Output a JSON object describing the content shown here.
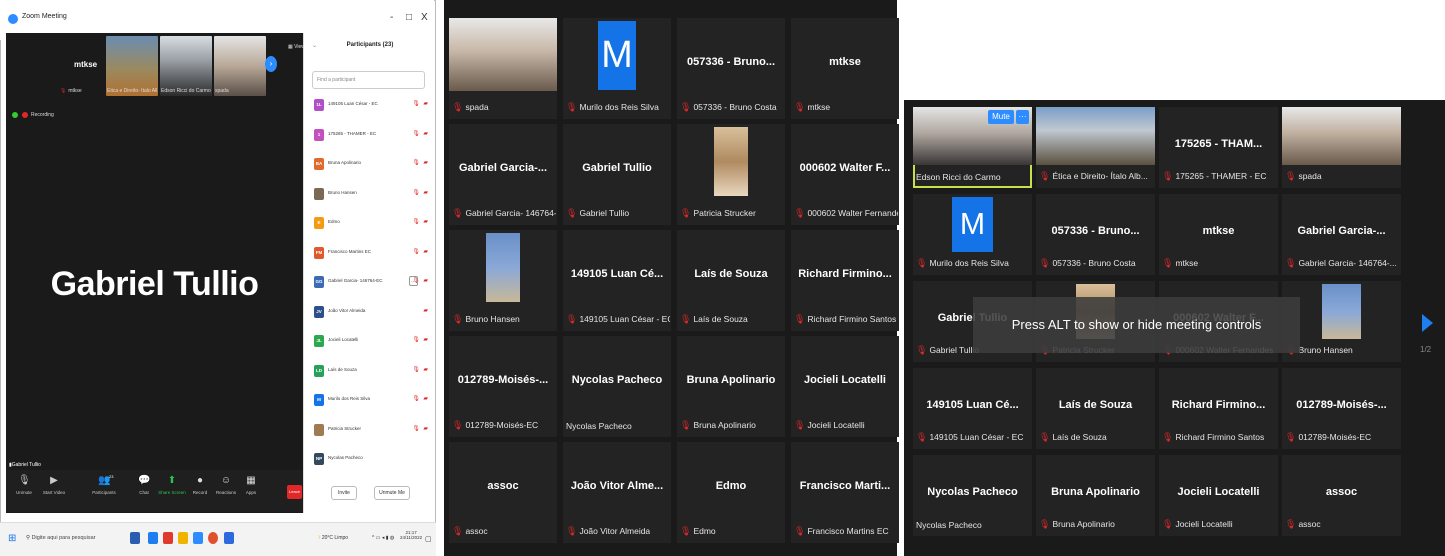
{
  "p1": {
    "title": "Zoom Meeting",
    "minimize_glyph": "-",
    "maximize_glyph": "□",
    "close_glyph": "X",
    "view_label": "View",
    "active_speaker": "Gabriel Tullio",
    "active_speaker_label": "Gabriel Tullio",
    "recording_label": "Recording",
    "strip": [
      {
        "name": "mtkse",
        "label": "mtkse"
      },
      {
        "label": "Ética e Direito- Ítalo Alb..."
      },
      {
        "label": "Edson Ricci do Carmo"
      },
      {
        "label": "spada"
      }
    ],
    "participants_title": "Participants (23)",
    "find_placeholder": "Find a participant",
    "participants": [
      {
        "initials": "1L",
        "name": "149105 Luan César - EC",
        "color": "#b04fc8"
      },
      {
        "initials": "1",
        "name": "175265 - THAMER - EC",
        "color": "#c34fc0"
      },
      {
        "initials": "BA",
        "name": "Bruna Apolinario",
        "color": "#e06a2c"
      },
      {
        "initials": "",
        "name": "Bruno Hansen",
        "color": "#7a6a55"
      },
      {
        "initials": "E",
        "name": "Edmo",
        "color": "#f39c12"
      },
      {
        "initials": "FM",
        "name": "Francisco Martins EC",
        "color": "#e05a2c"
      },
      {
        "initials": "GG",
        "name": "Gabriel Garcia- 146764-EC",
        "color": "#3d6ab5"
      },
      {
        "initials": "JV",
        "name": "João Vitor Almeida",
        "color": "#2d4f8a"
      },
      {
        "initials": "JL",
        "name": "Jocieli Locatelli",
        "color": "#2ea84f"
      },
      {
        "initials": "LD",
        "name": "Laís de Souza",
        "color": "#27a05a"
      },
      {
        "initials": "M",
        "name": "Murilo dos Reis Silva",
        "color": "#1473e6"
      },
      {
        "initials": "",
        "name": "Patricia Strucker",
        "color": "#a07a50"
      },
      {
        "initials": "NP",
        "name": "Nycolas Pacheco",
        "color": "#34495e"
      }
    ],
    "invite_label": "Invite",
    "unmute_me_label": "Unmute Me",
    "toolbar": [
      {
        "label": "Unmute",
        "icon": "mic-muted-icon",
        "glyph": "🎙"
      },
      {
        "label": "Start Video",
        "icon": "video-off-icon",
        "glyph": "▶"
      },
      {
        "label": "Participants",
        "icon": "participants-icon",
        "glyph": "👥",
        "badge": "23"
      },
      {
        "label": "Chat",
        "icon": "chat-icon",
        "glyph": "💬"
      },
      {
        "label": "Share Screen",
        "icon": "share-screen-icon",
        "glyph": "⬆"
      },
      {
        "label": "Record",
        "icon": "record-icon",
        "glyph": "●"
      },
      {
        "label": "Reactions",
        "icon": "reactions-icon",
        "glyph": "☺"
      },
      {
        "label": "Apps",
        "icon": "apps-icon",
        "glyph": "▦"
      }
    ],
    "leave_label": "Leave",
    "taskbar": {
      "search_placeholder": "Digite aqui para pesquisar",
      "weather": "20°C Limpo",
      "time": "21:17",
      "date": "24/11/2022"
    }
  },
  "p2": {
    "tiles": [
      {
        "type": "video",
        "label": "spada"
      },
      {
        "type": "letter",
        "letter": "M",
        "label": "Murilo dos Reis Silva"
      },
      {
        "type": "name",
        "name": "057336 - Bruno...",
        "label": "057336 - Bruno Costa"
      },
      {
        "type": "name",
        "name": "mtkse",
        "label": "mtkse"
      },
      {
        "type": "name",
        "name": "Gabriel Garcia-...",
        "label": "Gabriel Garcia- 146764-..."
      },
      {
        "type": "name",
        "name": "Gabriel Tullio",
        "label": "Gabriel Tullio"
      },
      {
        "type": "photo",
        "label": "Patricia Strucker"
      },
      {
        "type": "name",
        "name": "000602 Walter F...",
        "label": "000602 Walter Fernandes"
      },
      {
        "type": "photo",
        "label": "Bruno Hansen"
      },
      {
        "type": "name",
        "name": "149105 Luan Cé...",
        "label": "149105 Luan César - EC"
      },
      {
        "type": "name",
        "name": "Laís de Souza",
        "label": "Laís de Souza"
      },
      {
        "type": "name",
        "name": "Richard Firmino...",
        "label": "Richard Firmino Santos"
      },
      {
        "type": "name",
        "name": "012789-Moisés-...",
        "label": "012789-Moisés-EC"
      },
      {
        "type": "name",
        "name": "Nycolas Pacheco",
        "label": "Nycolas Pacheco",
        "nomic": true
      },
      {
        "type": "name",
        "name": "Bruna Apolinario",
        "label": "Bruna Apolinario"
      },
      {
        "type": "name",
        "name": "Jocieli Locatelli",
        "label": "Jocieli Locatelli"
      },
      {
        "type": "name",
        "name": "assoc",
        "label": "assoc"
      },
      {
        "type": "name",
        "name": "João Vitor Alme...",
        "label": "João Vitor Almeida"
      },
      {
        "type": "name",
        "name": "Edmo",
        "label": "Edmo"
      },
      {
        "type": "name",
        "name": "Francisco Marti...",
        "label": "Francisco Martins EC"
      }
    ]
  },
  "p3": {
    "mute_label": "Mute",
    "more_glyph": "···",
    "overlay_text": "Press ALT to show or hide meeting controls",
    "page_indicator": "1/2",
    "tiles": [
      {
        "type": "video",
        "label": "Edson Ricci do Carmo",
        "active": true,
        "nomic": true
      },
      {
        "type": "video",
        "label": "Ética e Direito- Ítalo Alb..."
      },
      {
        "type": "name",
        "name": "175265 - THAM...",
        "label": "175265 - THAMER - EC"
      },
      {
        "type": "video",
        "label": "spada"
      },
      {
        "type": "letter",
        "letter": "M",
        "label": "Murilo dos Reis Silva"
      },
      {
        "type": "name",
        "name": "057336 - Bruno...",
        "label": "057336 - Bruno Costa"
      },
      {
        "type": "name",
        "name": "mtkse",
        "label": "mtkse"
      },
      {
        "type": "name",
        "name": "Gabriel Garcia-...",
        "label": "Gabriel Garcia- 146764-..."
      },
      {
        "type": "name",
        "name": "Gabriel Tullio",
        "label": "Gabriel Tullio"
      },
      {
        "type": "photo",
        "label": "Patricia Strucker"
      },
      {
        "type": "name",
        "name": "000602 Walter F...",
        "label": "000602 Walter Fernandes"
      },
      {
        "type": "photo",
        "label": "Bruno Hansen"
      },
      {
        "type": "name",
        "name": "149105 Luan Cé...",
        "label": "149105 Luan César - EC"
      },
      {
        "type": "name",
        "name": "Laís de Souza",
        "label": "Laís de Souza"
      },
      {
        "type": "name",
        "name": "Richard Firmino...",
        "label": "Richard Firmino Santos"
      },
      {
        "type": "name",
        "name": "012789-Moisés-...",
        "label": "012789-Moisés-EC"
      },
      {
        "type": "name",
        "name": "Nycolas Pacheco",
        "label": "Nycolas Pacheco",
        "nomic": true
      },
      {
        "type": "name",
        "name": "Bruna Apolinario",
        "label": "Bruna Apolinario"
      },
      {
        "type": "name",
        "name": "Jocieli Locatelli",
        "label": "Jocieli Locatelli"
      },
      {
        "type": "name",
        "name": "assoc",
        "label": "assoc"
      }
    ]
  },
  "colors": {
    "zoom_blue": "#2d8cff",
    "muted_red": "#e02828",
    "tile_bg": "#232323",
    "grid_bg": "#1a1a1a",
    "active_border": "#c8e04a"
  }
}
